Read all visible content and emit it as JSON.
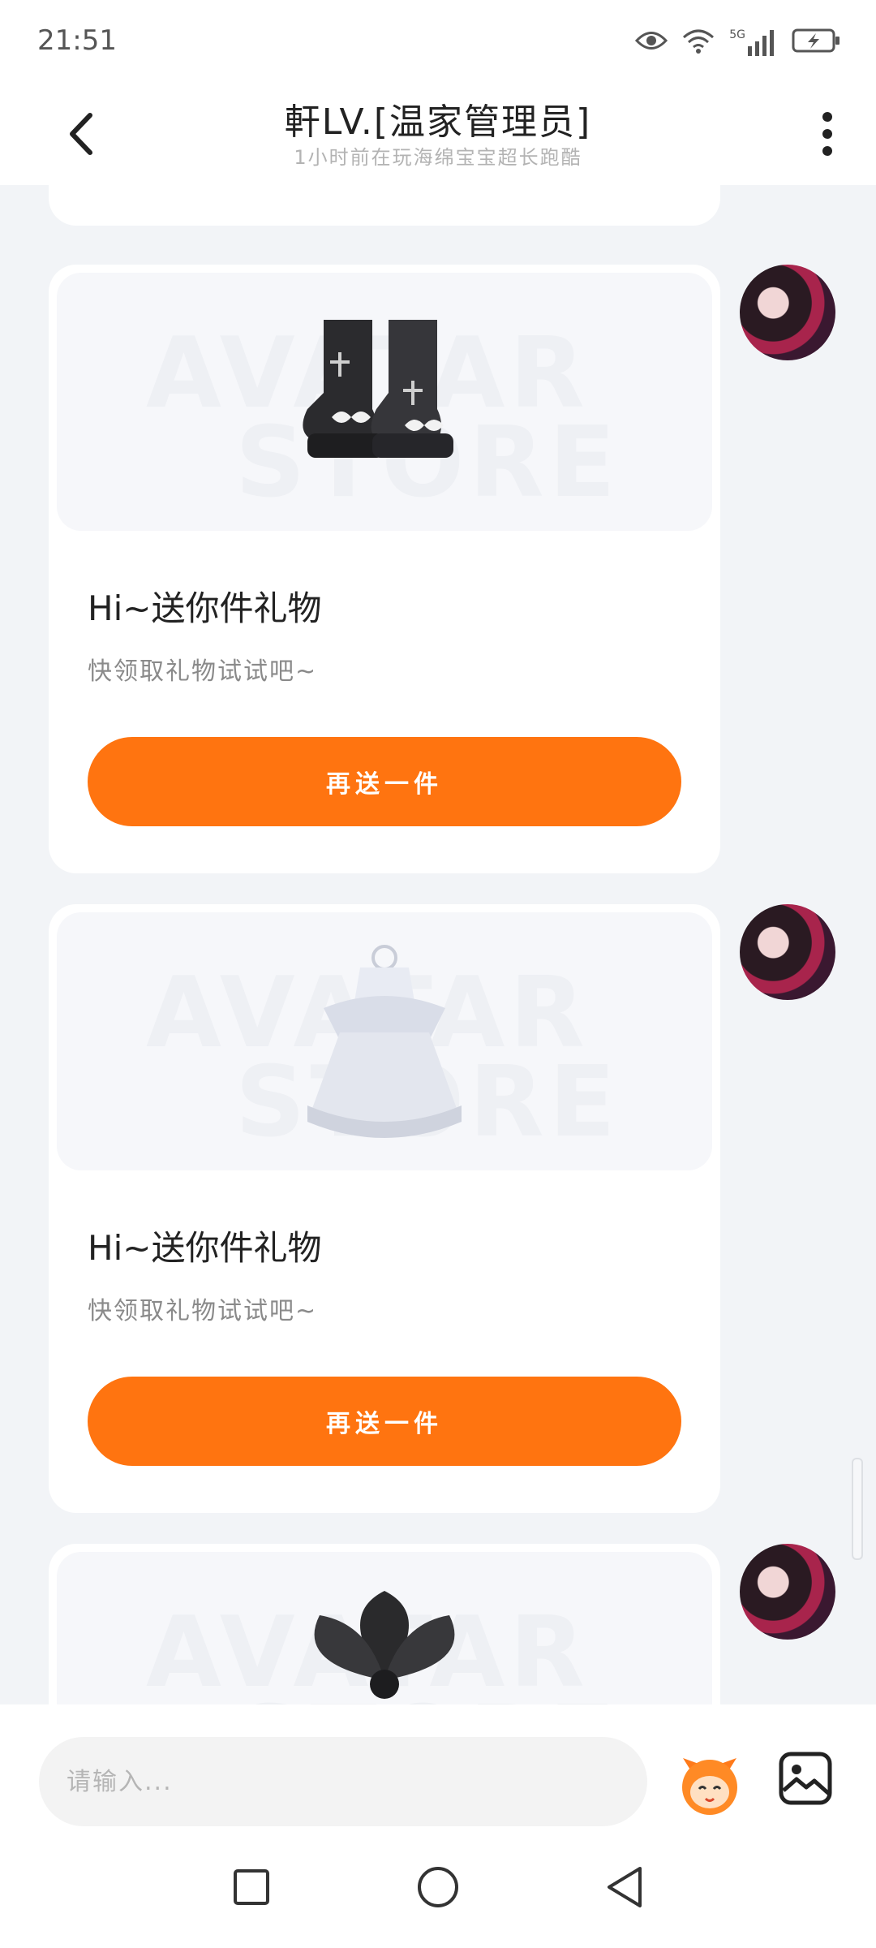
{
  "status_bar": {
    "time": "21:51",
    "network": "5G"
  },
  "header": {
    "title": "軒LV.[温家管理员]",
    "subtitle": "1小时前在玩海绵宝宝超长跑酷"
  },
  "watermark": {
    "line1": "AVATAR",
    "line2": "STORE"
  },
  "messages": [
    {
      "product_icon": "boots-icon",
      "title": "Hi~送你件礼物",
      "desc": "快领取礼物试试吧~",
      "button": "再送一件"
    },
    {
      "product_icon": "dress-icon",
      "title": "Hi~送你件礼物",
      "desc": "快领取礼物试试吧~",
      "button": "再送一件"
    },
    {
      "product_icon": "flower-hair-icon"
    }
  ],
  "input": {
    "placeholder": "请输入..."
  },
  "colors": {
    "accent": "#ff7410",
    "background": "#f2f4f7"
  }
}
